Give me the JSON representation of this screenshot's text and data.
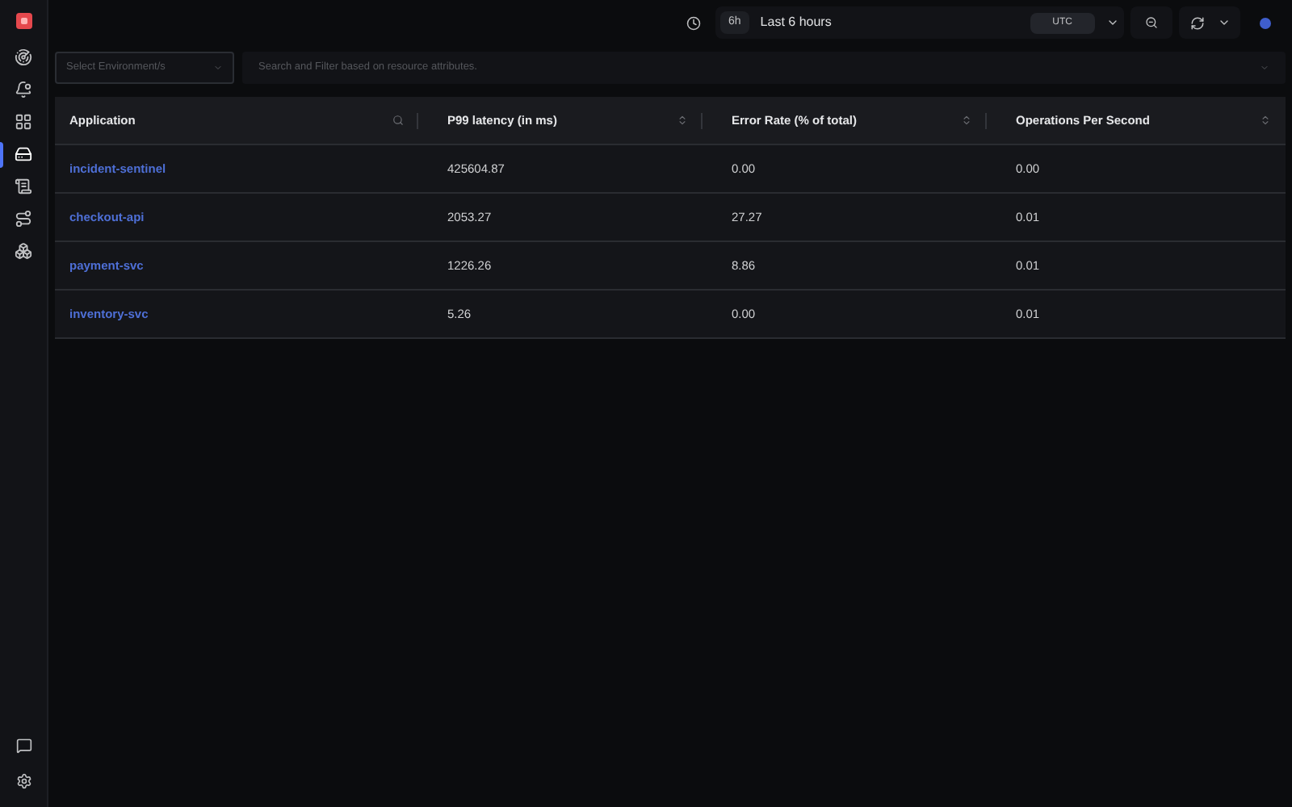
{
  "sidebar": {
    "items": [
      {
        "kind": "radar",
        "selected": false
      },
      {
        "kind": "bell",
        "selected": false
      },
      {
        "kind": "grid",
        "selected": false
      },
      {
        "kind": "drive",
        "selected": true
      },
      {
        "kind": "scroll",
        "selected": false
      },
      {
        "kind": "route",
        "selected": false
      },
      {
        "kind": "boxes",
        "selected": false
      }
    ]
  },
  "toolbar": {
    "range_badge": "6h",
    "range_label": "Last 6 hours",
    "timezone": "UTC"
  },
  "filters": {
    "environment_placeholder": "Select Environment/s",
    "search_placeholder": "Search and Filter based on resource attributes."
  },
  "table": {
    "columns": [
      {
        "label": "Application",
        "kind": "search"
      },
      {
        "label": "P99 latency (in ms)",
        "kind": "sort"
      },
      {
        "label": "Error Rate (% of total)",
        "kind": "sort"
      },
      {
        "label": "Operations Per Second",
        "kind": "sort"
      }
    ],
    "rows": [
      {
        "application": "incident-sentinel",
        "p99": "425604.87",
        "error_rate": "0.00",
        "ops": "0.00"
      },
      {
        "application": "checkout-api",
        "p99": "2053.27",
        "error_rate": "27.27",
        "ops": "0.01"
      },
      {
        "application": "payment-svc",
        "p99": "1226.26",
        "error_rate": "8.86",
        "ops": "0.01"
      },
      {
        "application": "inventory-svc",
        "p99": "5.26",
        "error_rate": "0.00",
        "ops": "0.01"
      }
    ]
  }
}
